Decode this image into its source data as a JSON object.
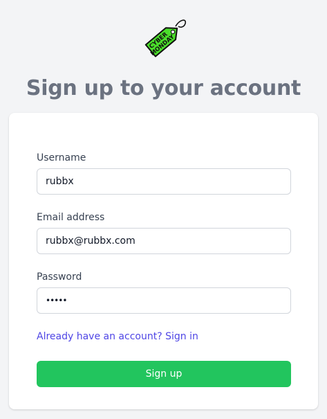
{
  "logo": {
    "text_line1": "CYBER",
    "text_line2": "MONDAY",
    "color": "#4ade2a"
  },
  "title": "Sign up to your account",
  "form": {
    "username": {
      "label": "Username",
      "value": "rubbx"
    },
    "email": {
      "label": "Email address",
      "value": "rubbx@rubbx.com"
    },
    "password": {
      "label": "Password",
      "value": "•••••"
    },
    "signin_link": "Already have an account? Sign in",
    "submit_label": "Sign up"
  },
  "colors": {
    "accent_green": "#22c55e",
    "link": "#4f46e5",
    "title": "#6b7280"
  }
}
